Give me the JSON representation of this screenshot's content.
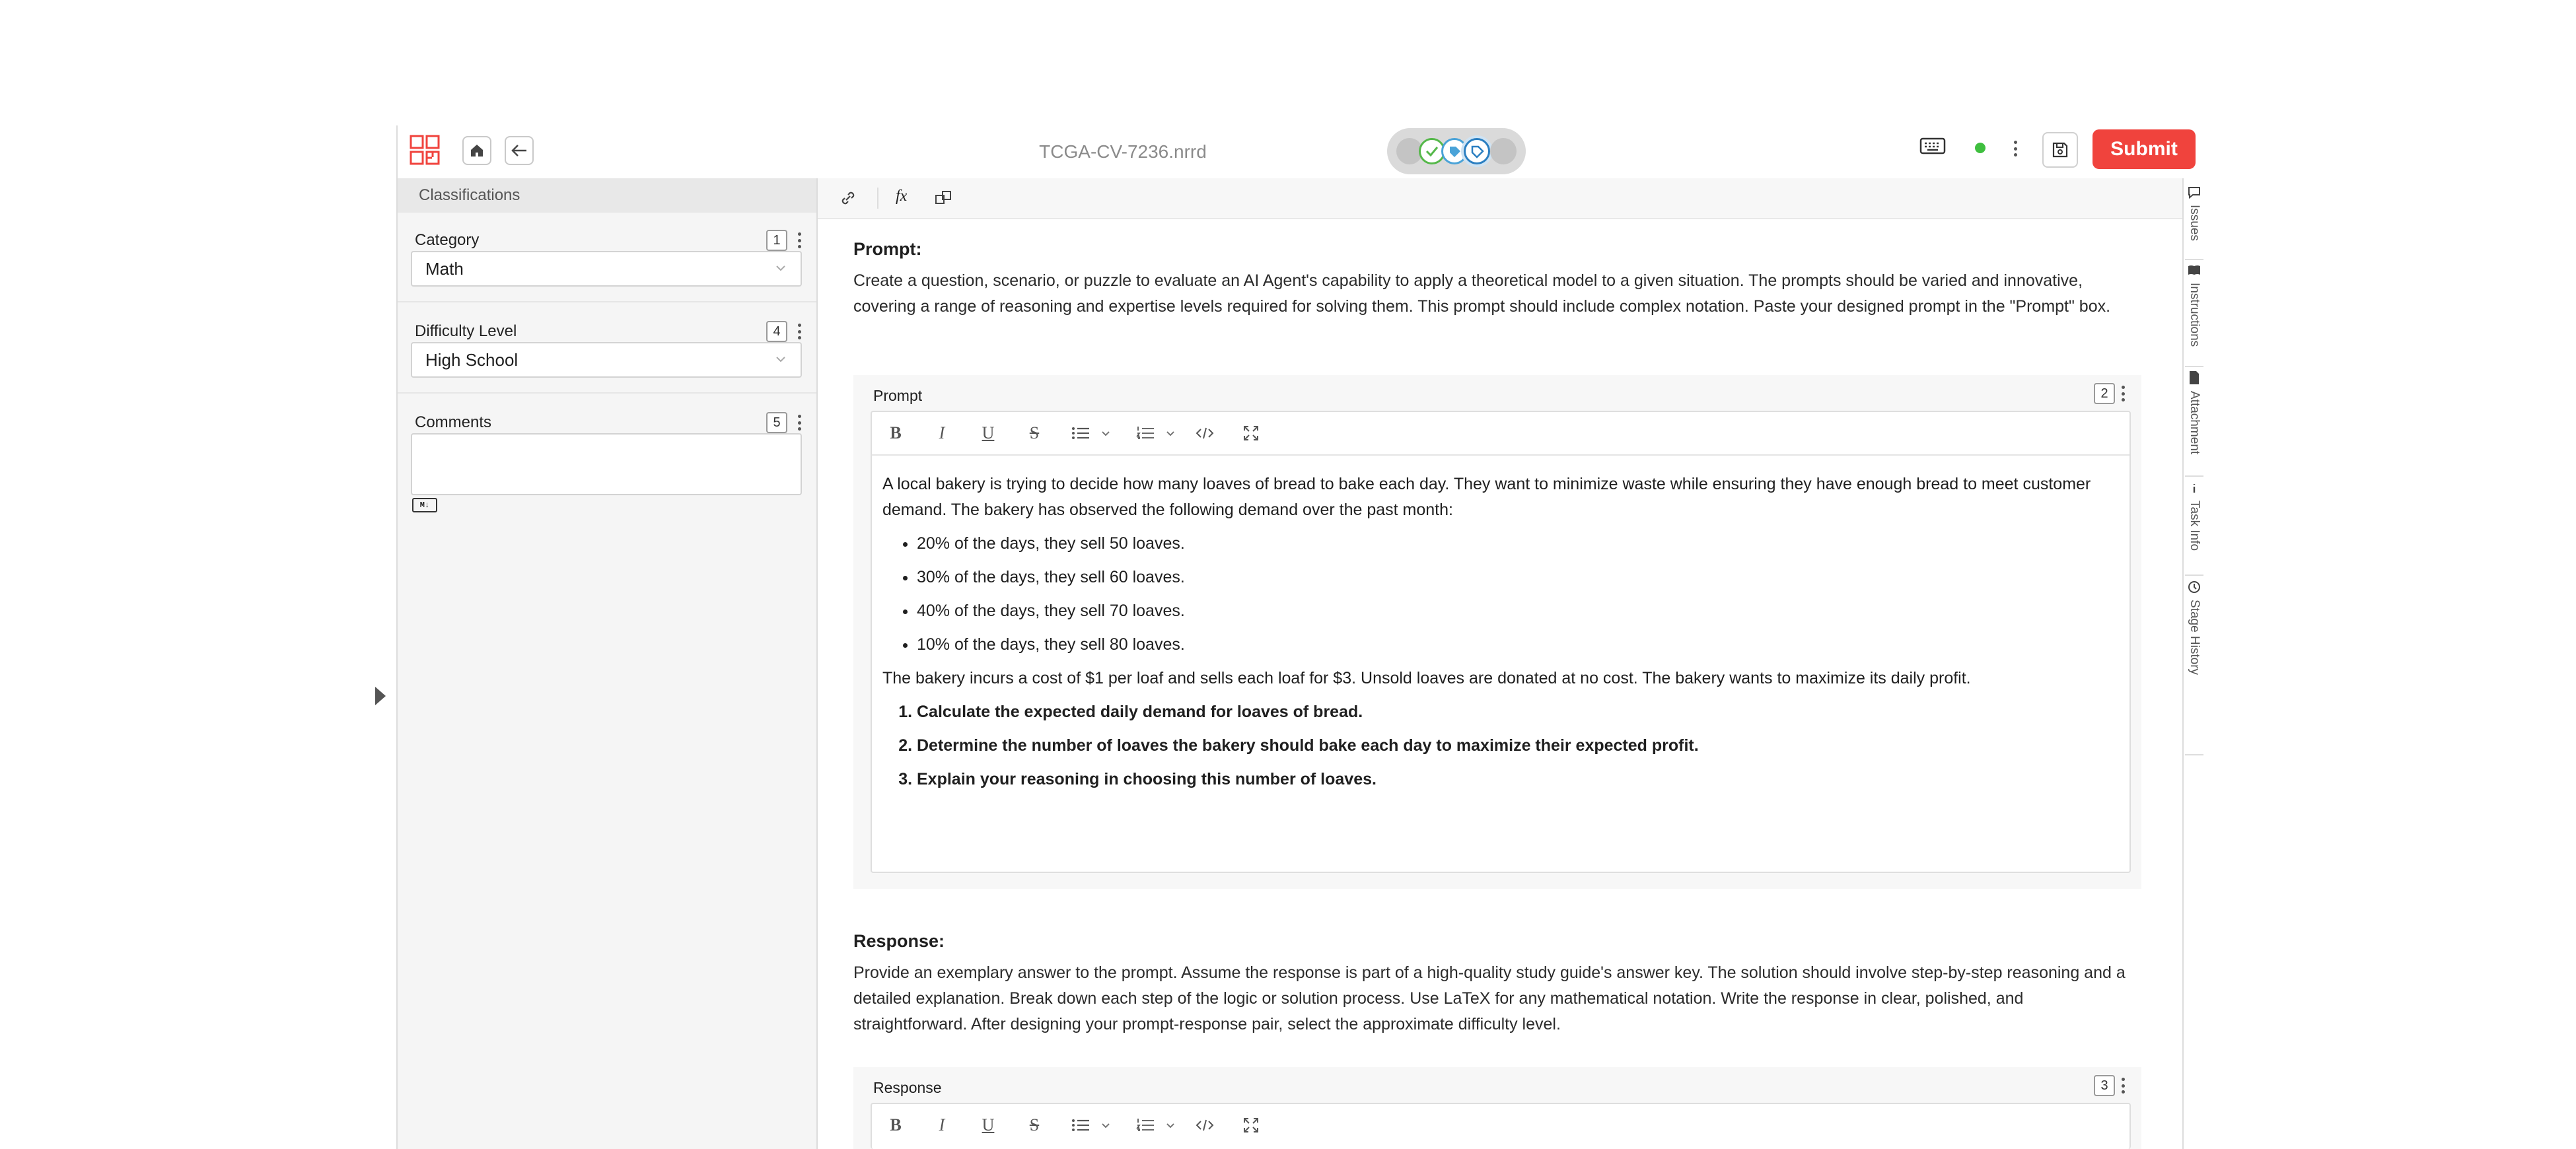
{
  "header": {
    "file_title": "TCGA-CV-7236.nrrd",
    "submit_label": "Submit",
    "status_color": "#3fbf3f",
    "accent_color": "#f0433d"
  },
  "left_panel": {
    "section_title": "Classifications",
    "fields": [
      {
        "label": "Category",
        "badge": "1",
        "value": "Math"
      },
      {
        "label": "Difficulty Level",
        "badge": "4",
        "value": "High School"
      },
      {
        "label": "Comments",
        "badge": "5",
        "value": "",
        "format_badge": "M↓"
      }
    ]
  },
  "main": {
    "toolbar": {
      "fx_label": "fx"
    },
    "prompt_heading": "Prompt:",
    "prompt_instructions": "Create a question, scenario, or puzzle to evaluate an AI Agent's capability to apply a theoretical model to a given situation. The prompts should be varied and innovative, covering a range of reasoning and expertise levels required for solving them. This prompt should include complex notation. Paste your designed prompt in the \"Prompt\" box.",
    "prompt_card": {
      "title": "Prompt",
      "badge": "2",
      "intro": "A local bakery is trying to decide how many loaves of bread to bake each day. They want to minimize waste while ensuring they have enough bread to meet customer demand. The bakery has observed the following demand over the past month:",
      "bullets": [
        "20% of the days, they sell 50 loaves.",
        "30% of the days, they sell 60 loaves.",
        "40% of the days, they sell 70 loaves.",
        "10% of the days, they sell 80 loaves."
      ],
      "cost_text": "The bakery incurs a cost of $1 per loaf and sells each loaf for $3. Unsold loaves are donated at no cost. The bakery wants to maximize its daily profit.",
      "questions": [
        "Calculate the expected daily demand for loaves of bread.",
        "Determine the number of loaves the bakery should bake each day to maximize their expected profit.",
        "Explain your reasoning in choosing this number of loaves."
      ]
    },
    "response_heading": "Response:",
    "response_instructions": "Provide an exemplary answer to the prompt. Assume the response is part of a high-quality study guide's answer key. The solution should involve step-by-step reasoning and a detailed explanation. Break down each step of the logic or solution process. Use LaTeX for any mathematical notation. Write the response in clear, polished, and straightforward. After designing your prompt-response pair, select the approximate difficulty level.",
    "response_card": {
      "title": "Response",
      "badge": "3"
    }
  },
  "right_rail": {
    "tabs": [
      "Issues",
      "Instructions",
      "Attachment",
      "Task Info",
      "Stage History"
    ]
  }
}
